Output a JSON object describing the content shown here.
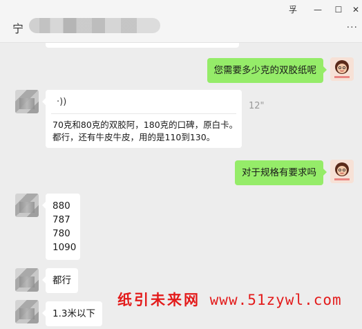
{
  "window": {
    "pin_glyph": "孚",
    "minimize_glyph": "—",
    "maximize_glyph": "☐",
    "close_glyph": "✕",
    "more_glyph": "···"
  },
  "contact": {
    "name_glyph": "宁"
  },
  "messages": [
    {
      "side": "right",
      "type": "text",
      "text": "您需要多少克的双胶纸呢"
    },
    {
      "side": "left",
      "type": "voice",
      "duration": "12\"",
      "transcript": "70克和80克的双胶阿，180克的口碑，原白卡。都行，还有牛皮牛皮，用的是110到130。"
    },
    {
      "side": "right",
      "type": "text",
      "text": "对于规格有要求吗"
    },
    {
      "side": "left",
      "type": "text",
      "lines": [
        "880",
        "787",
        "780",
        "1090"
      ]
    },
    {
      "side": "left",
      "type": "text",
      "text": "都行"
    },
    {
      "side": "left",
      "type": "text",
      "text": "1.3米以下"
    }
  ],
  "voice_icon": "·))",
  "watermark": {
    "cn": "纸引未来网",
    "url": "www.51zywl.com"
  },
  "colors": {
    "sent_bubble": "#95ec69",
    "received_bubble": "#ffffff",
    "watermark": "#e31b1b"
  }
}
